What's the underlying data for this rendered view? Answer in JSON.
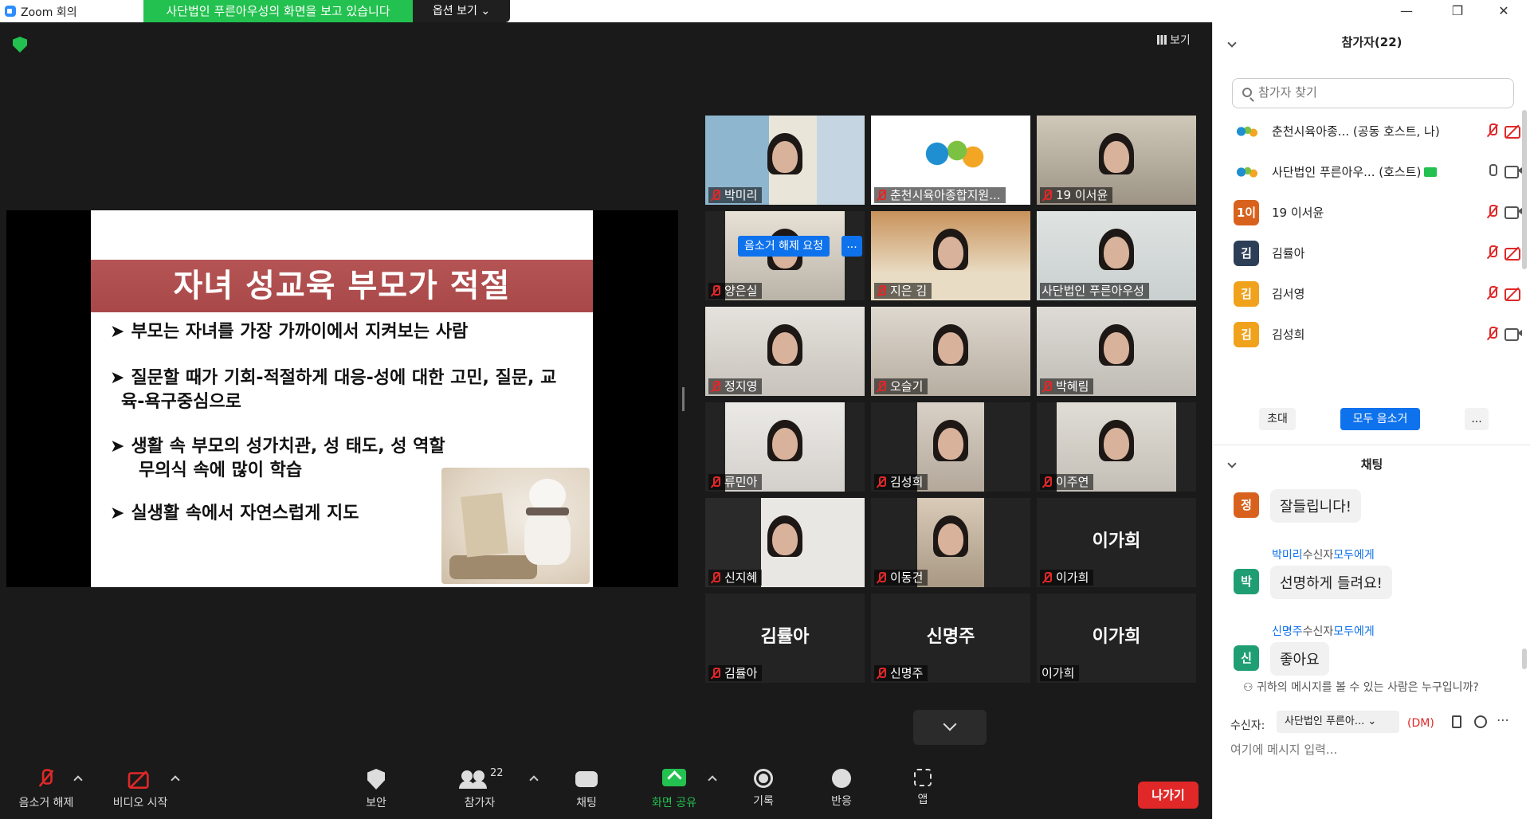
{
  "window": {
    "title": "Zoom 회의",
    "minimize": "—",
    "restore": "❐",
    "close": "✕"
  },
  "banner": {
    "sharing_text": "사단법인 푸른아우성의 화면을 보고 있습니다",
    "options_label": "옵션 보기"
  },
  "view_label": "보기",
  "slide": {
    "title": "자녀 성교육 부모가 적절",
    "bullets": [
      {
        "line1": "부모는 자녀를 가장 가까이에서 지켜보는 사람",
        "line2": ""
      },
      {
        "line1": "질문할 때가 기회-적절하게 대응-성에 대한 고민, 질문, 교",
        "line2": "육-욕구중심으로"
      },
      {
        "line1": "생활 속 부모의 성가치관, 성 태도, 성 역할",
        "line2": "무의식 속에 많이 학습"
      },
      {
        "line1": "실생활 속에서 자연스럽게 지도",
        "line2": ""
      }
    ]
  },
  "tiles": [
    {
      "name": "박미리",
      "muted": true
    },
    {
      "name": "춘천시육아종합지원...",
      "muted": true
    },
    {
      "name": "19 이서윤",
      "muted": true
    },
    {
      "name": "양은실",
      "muted": true
    },
    {
      "name": "지은 김",
      "muted": true
    },
    {
      "name": "사단법인 푸른아우성",
      "muted": false
    },
    {
      "name": "정지영",
      "muted": true
    },
    {
      "name": "오슬기",
      "muted": true
    },
    {
      "name": "박혜림",
      "muted": true
    },
    {
      "name": "류민아",
      "muted": true
    },
    {
      "name": "김성희",
      "muted": true
    },
    {
      "name": "이주연",
      "muted": true
    },
    {
      "name": "신지혜",
      "muted": true
    },
    {
      "name": "이동건",
      "muted": true
    },
    {
      "name": "이가희",
      "muted": true,
      "bigname": "이가희"
    },
    {
      "name": "김률아",
      "muted": true,
      "bigname": "김률아"
    },
    {
      "name": "신명주",
      "muted": true,
      "bigname": "신명주"
    },
    {
      "name": "이가희",
      "muted": false,
      "bigname": "이가희"
    }
  ],
  "unmute_request": "음소거 해제 요청",
  "more": "...",
  "toolbar": {
    "unmute": "음소거 해제",
    "start_video": "비디오 시작",
    "security": "보안",
    "participants": "참가자",
    "participants_count": "22",
    "chat": "채팅",
    "share": "화면 공유",
    "record": "기록",
    "reactions": "반응",
    "apps": "앱",
    "leave": "나가기"
  },
  "panel": {
    "participants_title": "참가자(22)",
    "search_placeholder": "참가자 찾기",
    "participants": [
      {
        "avatar": "",
        "name": "춘천시육아종...",
        "role": "(공동 호스트, 나)",
        "color": "#ffffff"
      },
      {
        "avatar": "",
        "name": "사단법인 푸른아우...",
        "role": "(호스트)",
        "color": "#ffffff"
      },
      {
        "avatar": "1이",
        "name": "19 이서윤",
        "role": "",
        "color": "#d8621d"
      },
      {
        "avatar": "김",
        "name": "김률아",
        "role": "",
        "color": "#2d3e57"
      },
      {
        "avatar": "김",
        "name": "김서영",
        "role": "",
        "color": "#f0a21c"
      },
      {
        "avatar": "김",
        "name": "김성희",
        "role": "",
        "color": "#f0a21c"
      }
    ],
    "invite": "초대",
    "mute_all": "모두 음소거",
    "more": "...",
    "chat_title": "채팅",
    "messages": [
      {
        "avatar": "정",
        "color": "#d8621d",
        "sender": "",
        "to_label": "",
        "to_target": "",
        "text": "잘들립니다!"
      },
      {
        "avatar": "박",
        "color": "#1f9e74",
        "sender": "박미리",
        "to_label": "수신자",
        "to_target": "모두에게",
        "text": "선명하게 들려요!"
      },
      {
        "avatar": "신",
        "color": "#1f9e74",
        "sender": "신명주",
        "to_label": "수신자",
        "to_target": "모두에게",
        "text": "좋아요"
      }
    ],
    "who_can_see": "귀하의 메시지를 볼 수 있는 사람은 누구입니까?",
    "recipient_label": "수신자:",
    "recipient_value": "사단법인 푸른아...",
    "dm": "(DM)",
    "input_placeholder": "여기에 메시지 입력..."
  }
}
